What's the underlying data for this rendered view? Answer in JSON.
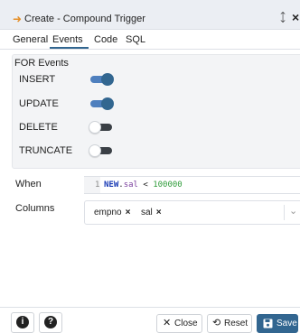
{
  "dialog": {
    "title_arrow": "➜",
    "title": "Create - Compound Trigger",
    "expand_icon": "⤢",
    "close_icon": "×"
  },
  "tabs": [
    {
      "label": "General"
    },
    {
      "label": "Events"
    },
    {
      "label": "Code"
    },
    {
      "label": "SQL"
    }
  ],
  "active_tab": "Events",
  "for_events": {
    "title": "FOR Events",
    "items": [
      {
        "label": "INSERT",
        "enabled": true
      },
      {
        "label": "UPDATE",
        "enabled": true
      },
      {
        "label": "DELETE",
        "enabled": false
      },
      {
        "label": "TRUNCATE",
        "enabled": false
      }
    ]
  },
  "when": {
    "label": "When",
    "line_number": "1",
    "code": {
      "keyword": "NEW",
      "dot": ".",
      "identifier": "sal",
      "operator": " < ",
      "number": "100000"
    }
  },
  "columns": {
    "label": "Columns",
    "chips": [
      {
        "label": "empno",
        "remove": "×"
      },
      {
        "label": "sal",
        "remove": "×"
      }
    ],
    "chevron": "⌄"
  },
  "footer": {
    "info_icon": "i",
    "help_icon": "?",
    "close_icon": "✕",
    "close_label": "Close",
    "reset_icon": "⟲",
    "reset_label": "Reset",
    "save_label": "Save"
  },
  "colors": {
    "accent": "#326690",
    "toggle_on": "#4e7fbe"
  }
}
